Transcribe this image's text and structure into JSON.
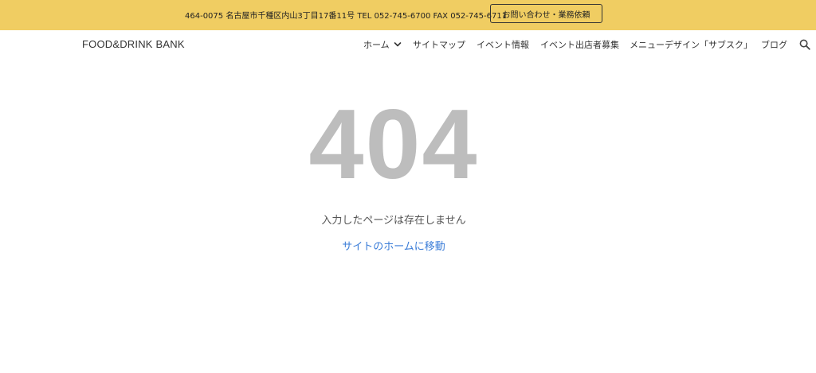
{
  "topbar": {
    "address": "464-0075 名古屋市千種区内山3丁目17番11号 TEL 052-745-6700 FAX 052-745-6711",
    "contact_button": "お問い合わせ・業務依頼",
    "background_color": "#f0cd62"
  },
  "header": {
    "brand": "FOOD&DRINK BANK",
    "nav": [
      {
        "label": "ホーム",
        "icon": "chevron-down-icon"
      },
      {
        "label": "サイトマップ"
      },
      {
        "label": "イベント情報"
      },
      {
        "label": "イベント出店者募集"
      },
      {
        "label": "メニューデザイン「サブスク」"
      },
      {
        "label": "ブログ"
      }
    ],
    "search_icon": "search-icon"
  },
  "main": {
    "error_code": "404",
    "message": "入力したページは存在しません",
    "home_link": "サイトのホームに移動",
    "link_color": "#3b7dd8"
  }
}
